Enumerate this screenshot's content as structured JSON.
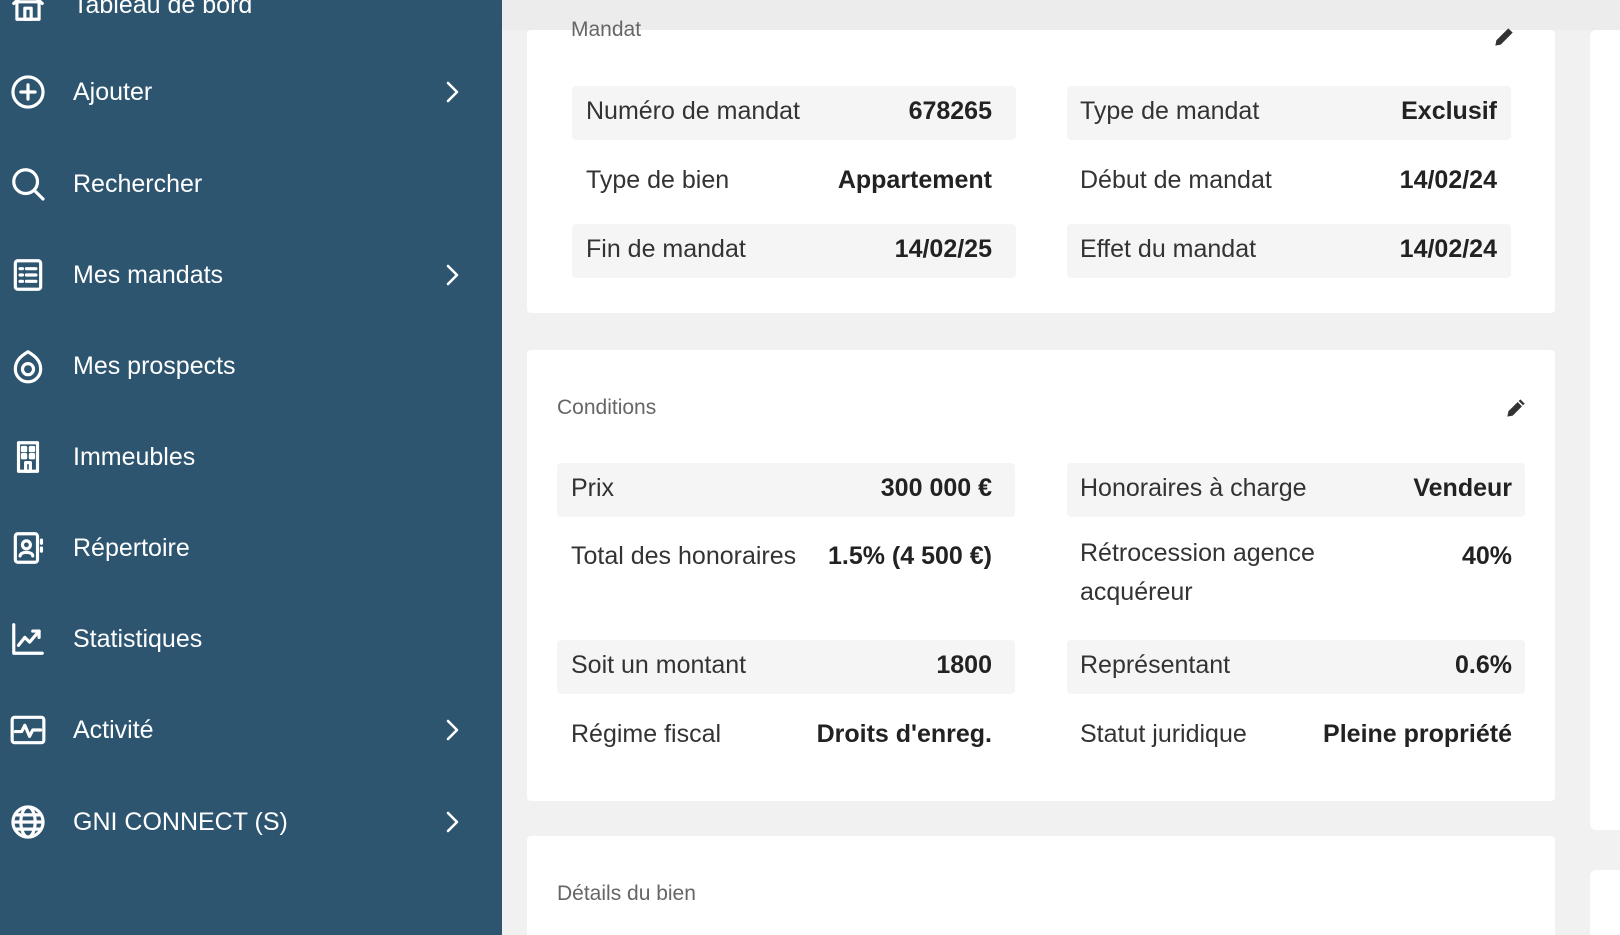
{
  "sidebar": {
    "items": [
      {
        "label": "Tableau de bord",
        "icon": "home-icon"
      },
      {
        "label": "Ajouter",
        "icon": "plus-circle-icon"
      },
      {
        "label": "Rechercher",
        "icon": "search-icon"
      },
      {
        "label": "Mes mandats",
        "icon": "list-icon"
      },
      {
        "label": "Mes prospects",
        "icon": "prospect-icon"
      },
      {
        "label": "Immeubles",
        "icon": "building-icon"
      },
      {
        "label": "Répertoire",
        "icon": "contact-book-icon"
      },
      {
        "label": "Statistiques",
        "icon": "chart-icon"
      },
      {
        "label": "Activité",
        "icon": "activity-icon"
      },
      {
        "label": "GNI CONNECT (S)",
        "icon": "globe-icon"
      }
    ],
    "bg_color": "#2d5570"
  },
  "mandat": {
    "title": "Mandat",
    "rows": [
      {
        "label": "Numéro de mandat",
        "value": "678265"
      },
      {
        "label": "Type de mandat",
        "value": "Exclusif"
      },
      {
        "label": "Type de bien",
        "value": "Appartement"
      },
      {
        "label": "Début de mandat",
        "value": "14/02/24"
      },
      {
        "label": "Fin de mandat",
        "value": "14/02/25"
      },
      {
        "label": "Effet du mandat",
        "value": "14/02/24"
      }
    ]
  },
  "conditions": {
    "title": "Conditions",
    "rows": [
      {
        "label": "Prix",
        "value": "300 000 €"
      },
      {
        "label": "Honoraires à charge",
        "value": "Vendeur"
      },
      {
        "label": "Total des honoraires",
        "value": "1.5% (4 500 €)"
      },
      {
        "label": "Rétrocession agence acquéreur",
        "value": "40%"
      },
      {
        "label": "Soit un montant",
        "value": "1800"
      },
      {
        "label": "Représentant",
        "value": "0.6%"
      },
      {
        "label": "Régime fiscal",
        "value": "Droits d'enreg."
      },
      {
        "label": "Statut juridique",
        "value": "Pleine propriété"
      }
    ]
  },
  "details": {
    "title": "Détails du bien"
  }
}
